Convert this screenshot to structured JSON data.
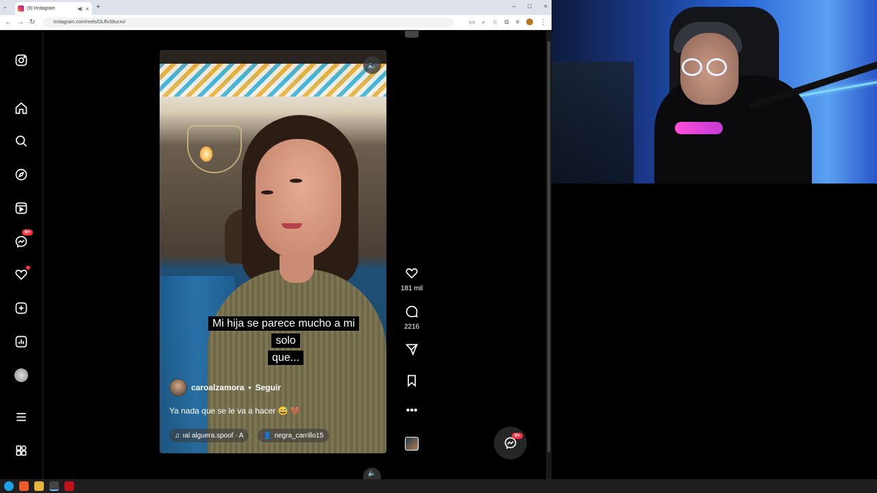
{
  "browser": {
    "tab_title": "(9) Instagram",
    "url": "instagram.com/reels/DLffv38ucxv/",
    "new_tab": "+",
    "window_controls": [
      "–",
      "□",
      "×"
    ]
  },
  "sidebar": {
    "messages_badge": "9+",
    "items": [
      {
        "name": "instagram-logo-icon"
      },
      {
        "name": "home-icon"
      },
      {
        "name": "search-icon"
      },
      {
        "name": "explore-icon"
      },
      {
        "name": "reels-icon"
      },
      {
        "name": "messenger-icon"
      },
      {
        "name": "heart-icon"
      },
      {
        "name": "create-icon"
      },
      {
        "name": "dashboard-icon"
      },
      {
        "name": "profile-avatar"
      },
      {
        "name": "menu-icon"
      },
      {
        "name": "also-from-meta-icon"
      }
    ]
  },
  "reel": {
    "caption": "Mi hija se parece mucho a mi solo que...",
    "caption_line1": "Mi hija se parece mucho a mi solo",
    "caption_line2": "que...",
    "author": "caroalzamora",
    "separator": "•",
    "follow_label": "Seguir",
    "post_text": "Ya nada que se le va a hacer 😅 🤎",
    "audio": "ıal   alguera.spoof · A",
    "tagged_user": "negra_carrillo15"
  },
  "actions": {
    "likes": "181 mil",
    "comments": "2216"
  },
  "messages_fab_badge": "9+",
  "colors": {
    "badge": "#ff3040",
    "background": "#000000"
  }
}
